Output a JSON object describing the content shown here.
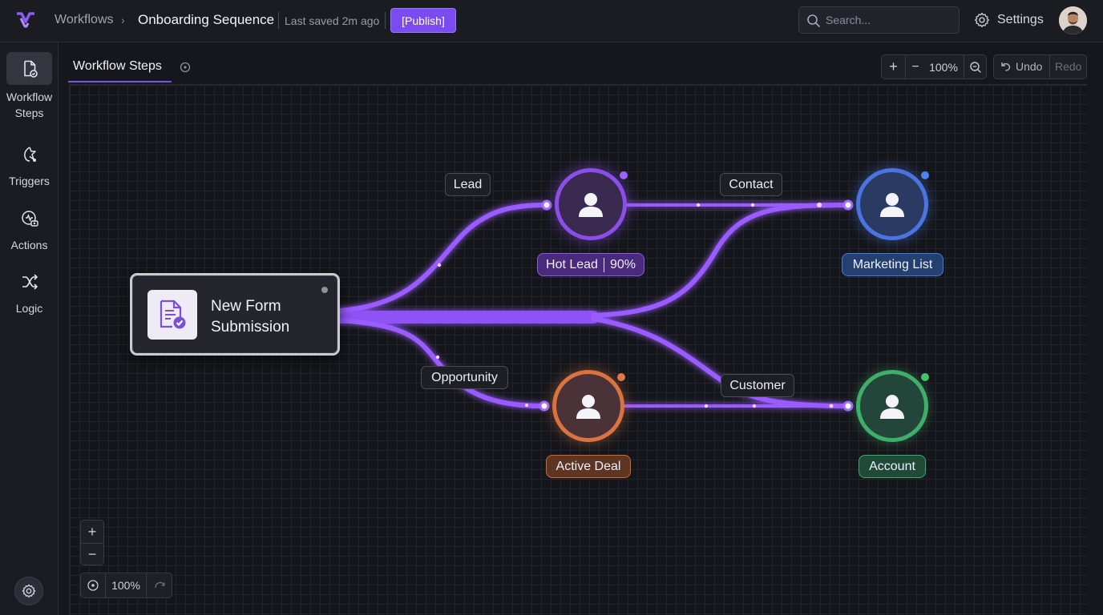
{
  "header": {
    "breadcrumb_root": "Workflows",
    "breadcrumb_separator": "›",
    "title": "Onboarding Sequence",
    "last_saved": "Last saved 2m ago",
    "publish_label": "[Publish]",
    "search_placeholder": "Search...",
    "settings_label": "Settings"
  },
  "sidebar": {
    "items": [
      {
        "line1": "Workflow",
        "line2": "Steps",
        "icon": "document-check-icon"
      },
      {
        "line1": "Triggers",
        "icon": "trigger-icon"
      },
      {
        "line1": "Actions",
        "icon": "actions-icon"
      },
      {
        "line1": "Logic",
        "icon": "shuffle-icon"
      }
    ]
  },
  "tabbar": {
    "tab_label": "Workflow Steps",
    "zoom_in": "+",
    "zoom_out": "−",
    "zoom_level": "100%",
    "undo_label": "Undo",
    "redo_label": "Redo"
  },
  "canvas": {
    "source_node": {
      "label_line1": "New Form",
      "label_line2": "Submission"
    },
    "edge_labels": {
      "lead": "Lead",
      "contact": "Contact",
      "opportunity": "Opportunity",
      "customer": "Customer"
    },
    "nodes": {
      "hot_lead": {
        "label": "Hot Lead",
        "score": "90%",
        "color": "#8a4fe8"
      },
      "marketing_list": {
        "label": "Marketing List",
        "color": "#4a74e0"
      },
      "active_deal": {
        "label": "Active Deal",
        "color": "#d9733f"
      },
      "account": {
        "label": "Account",
        "color": "#3fae6b"
      }
    },
    "controls": {
      "zoom_in": "+",
      "zoom_out": "−",
      "zoom_level": "100%"
    }
  },
  "colors": {
    "accent": "#7a4cf0",
    "edge": "#9b5cff"
  }
}
